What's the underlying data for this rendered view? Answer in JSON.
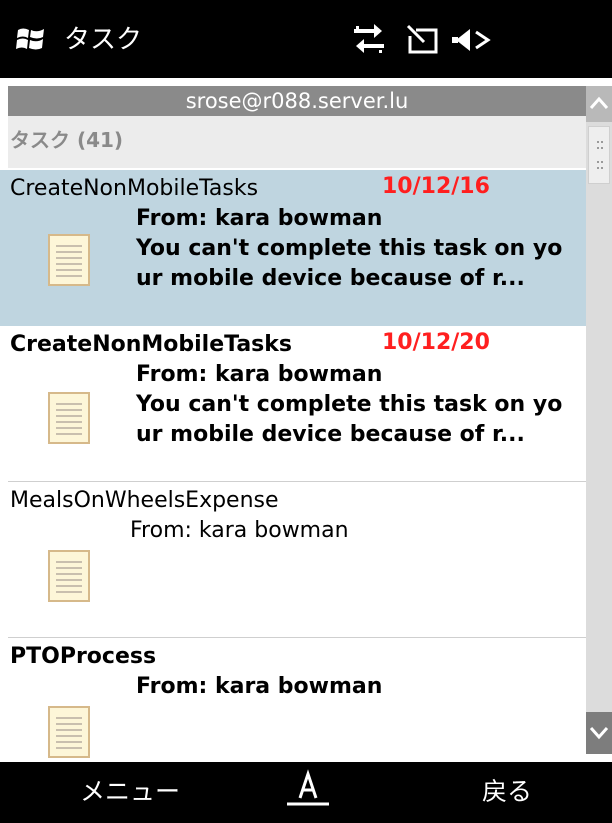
{
  "topbar": {
    "app_title": "タスク",
    "icons": [
      "windows-logo-icon",
      "sync-arrows-icon",
      "no-sim-icon",
      "speaker-muted-icon"
    ]
  },
  "account": {
    "email": "srose@r088.server.lu"
  },
  "group": {
    "label": "タスク (41)"
  },
  "tasks": [
    {
      "title": "CreateNonMobileTasks",
      "date": "10/12/16",
      "from": "From: kara bowman",
      "body": "You can't complete this task on your mobile device because of r...",
      "selected": true,
      "bold": true
    },
    {
      "title": "CreateNonMobileTasks",
      "date": "10/12/20",
      "from": "From: kara bowman",
      "body": "You can't complete this task on your mobile device because of r...",
      "selected": false,
      "bold": true
    },
    {
      "title": "MealsOnWheelsExpense",
      "date": "",
      "from": "From: kara bowman",
      "body": "",
      "selected": false,
      "bold": false
    },
    {
      "title": "PTOProcess",
      "date": "",
      "from": "From: kara bowman",
      "body": "",
      "selected": false,
      "bold": true
    }
  ],
  "softkeys": {
    "left": "メニュー",
    "right": "戻る",
    "center_icon": "input-mode-icon"
  },
  "colors": {
    "selected_row": "#bfd5e0",
    "date_red": "#ff1f1f",
    "account_bar": "#8a8a8a"
  }
}
